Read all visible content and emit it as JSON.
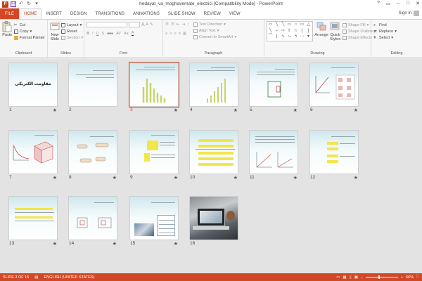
{
  "app": {
    "title": "hedayat_va_moghavemate_electrici [Compatibility Mode] - PowerPoint",
    "icon_label": "P",
    "accent": "#d24726"
  },
  "qat": {
    "save_icon": "save-icon",
    "undo_icon": "undo-icon",
    "redo_icon": "redo-icon"
  },
  "window": {
    "help": "?",
    "ribbon_display": "▭",
    "minimize": "–",
    "maximize": "□",
    "close": "✕"
  },
  "tabs": [
    {
      "label": "FILE"
    },
    {
      "label": "HOME"
    },
    {
      "label": "INSERT"
    },
    {
      "label": "DESIGN"
    },
    {
      "label": "TRANSITIONS"
    },
    {
      "label": "ANIMATIONS"
    },
    {
      "label": "SLIDE SHOW"
    },
    {
      "label": "REVIEW"
    },
    {
      "label": "VIEW"
    }
  ],
  "signin": "Sign in",
  "ribbon": {
    "clipboard": {
      "paste": "Paste",
      "cut": "Cut",
      "copy": "Copy",
      "format_painter": "Format Painter",
      "label": "Clipboard"
    },
    "slides": {
      "new_slide_1": "New",
      "new_slide_2": "Slide",
      "layout": "Layout",
      "reset": "Reset",
      "section": "Section",
      "label": "Slides"
    },
    "font": {
      "label": "Font",
      "bold": "B",
      "italic": "I",
      "underline": "U",
      "strike": "S",
      "shadow": "abc",
      "spacing": "AV",
      "case": "Aa",
      "color": "A",
      "grow": "A",
      "shrink": "A"
    },
    "paragraph": {
      "label": "Paragraph",
      "text_direction": "Text Direction",
      "align_text": "Align Text",
      "convert": "Convert to SmartArt"
    },
    "drawing": {
      "label": "Drawing",
      "arrange": "Arrange",
      "quick_styles_1": "Quick",
      "quick_styles_2": "Styles",
      "shape_fill": "Shape Fill",
      "shape_outline": "Shape Outline",
      "shape_effects": "Shape Effects"
    },
    "editing": {
      "label": "Editing",
      "find": "Find",
      "replace": "Replace",
      "select": "Select"
    }
  },
  "slides": [
    {
      "num": "1",
      "star": "★",
      "title": "مقاومت الکتریکی"
    },
    {
      "num": "2",
      "star": ""
    },
    {
      "num": "3",
      "star": "★"
    },
    {
      "num": "4",
      "star": "★"
    },
    {
      "num": "5",
      "star": "★"
    },
    {
      "num": "6",
      "star": "★"
    },
    {
      "num": "7",
      "star": "★"
    },
    {
      "num": "8",
      "star": "★"
    },
    {
      "num": "9",
      "star": "★"
    },
    {
      "num": "10",
      "star": "★"
    },
    {
      "num": "11",
      "star": "★"
    },
    {
      "num": "12",
      "star": "★"
    },
    {
      "num": "13",
      "star": "★"
    },
    {
      "num": "14",
      "star": "★"
    },
    {
      "num": "15",
      "star": "★"
    },
    {
      "num": "16",
      "star": ""
    }
  ],
  "selected_slide": 3,
  "status": {
    "slide_info": "SLIDE 3 OF 16",
    "language": "ENGLISH (UNITED STATES)",
    "zoom": "66%",
    "zoom_minus": "–",
    "zoom_plus": "+"
  }
}
